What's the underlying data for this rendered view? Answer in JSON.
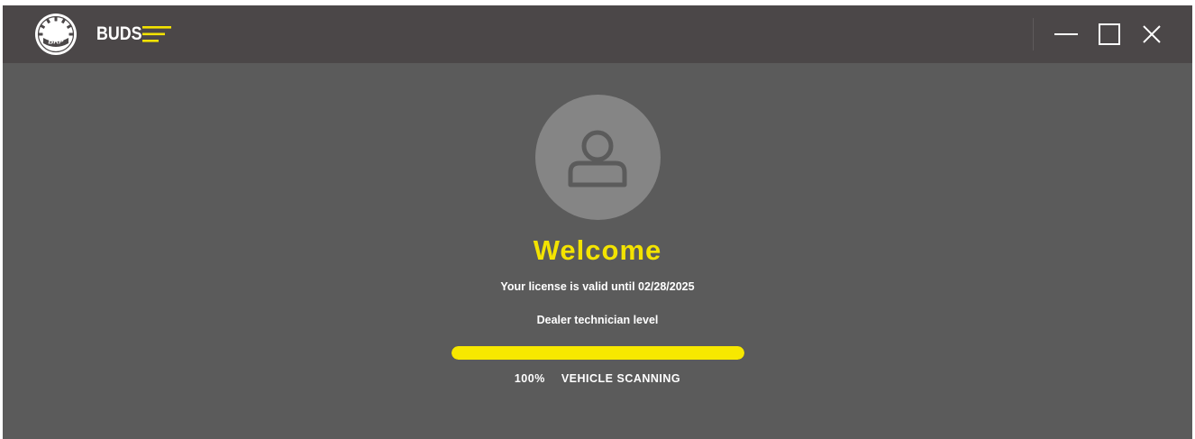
{
  "titlebar": {
    "logo_text": "BRP",
    "app_name": "BUDS",
    "icons": {
      "logo": "brp-logo-icon",
      "menu": "hamburger-menu-icon",
      "minimize": "minimize-icon",
      "maximize": "maximize-icon",
      "close": "close-icon"
    }
  },
  "main": {
    "avatar_icon": "user-icon",
    "welcome": "Welcome",
    "license_text": "Your license is valid until 02/28/2025",
    "level_text": "Dealer technician level",
    "progress": {
      "percent": 100,
      "percent_label": "100%",
      "status_label": "VEHICLE SCANNING"
    }
  },
  "colors": {
    "accent": "#f3e300",
    "titlebar": "#4b4748",
    "background": "#5b5b5b",
    "avatar": "#858585"
  }
}
